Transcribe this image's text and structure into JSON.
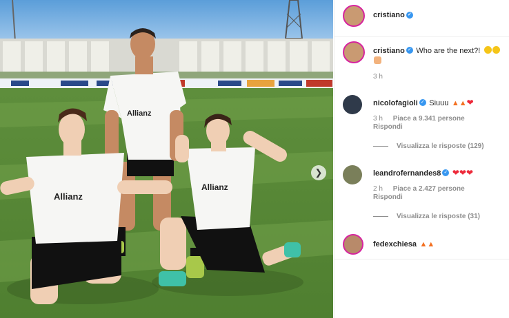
{
  "post": {
    "author": "cristiano",
    "caption_author": "cristiano",
    "caption_text": "Who are the next?!",
    "caption_time": "3 h"
  },
  "comments": [
    {
      "user": "nicolofagioli",
      "text": "Siuuu",
      "emojis": [
        "fire",
        "fire",
        "heart"
      ],
      "time": "3 h",
      "likes": "Piace a 9.341 persone",
      "reply": "Rispondi",
      "view_replies": "Visualizza le risposte (129)"
    },
    {
      "user": "leandrofernandes8",
      "text": "",
      "emojis": [
        "heart",
        "heart",
        "heart"
      ],
      "time": "2 h",
      "likes": "Piace a 2.427 persone",
      "reply": "Rispondi",
      "view_replies": "Visualizza le risposte (31)"
    },
    {
      "user": "fedexchiesa",
      "text": "",
      "emojis": [
        "fire",
        "fire"
      ]
    }
  ],
  "icons": {
    "verified": "verified-badge-icon",
    "next": "chevron-right-icon",
    "heart": "heart-icon"
  },
  "colors": {
    "verified": "#3897f0",
    "story_ring": "#d6249f",
    "meta_text": "#8e8e8e"
  }
}
